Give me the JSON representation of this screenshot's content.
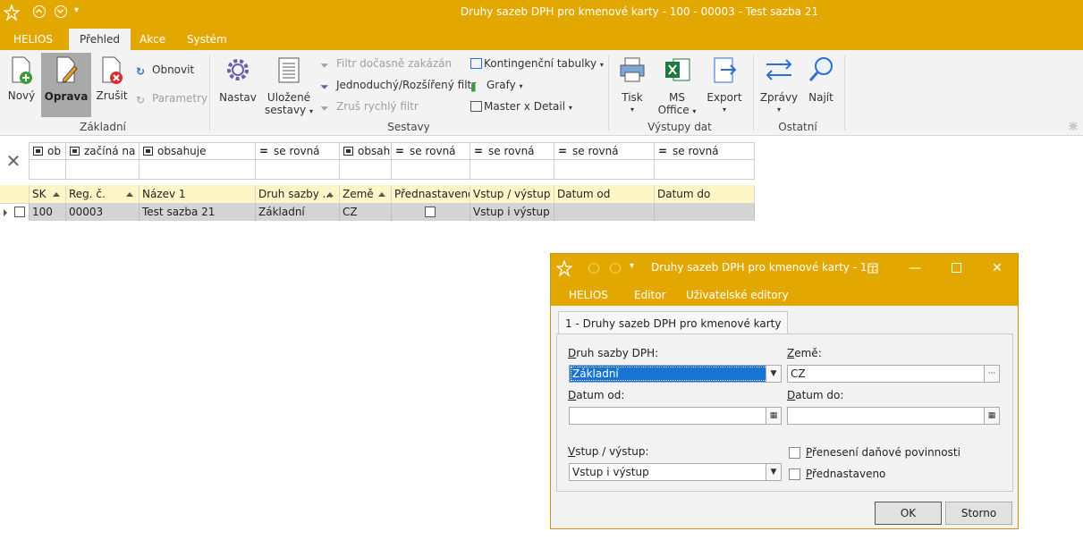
{
  "window": {
    "title": "Druhy sazeb DPH pro kmenové karty - 100 - 00003 - Test sazba 21"
  },
  "ribbon_tabs": [
    "HELIOS",
    "Přehled",
    "Akce",
    "Systém"
  ],
  "ribbon": {
    "zakladni": {
      "new": "Nový",
      "edit": "Oprava",
      "delete": "Zrušit",
      "refresh": "Obnovit",
      "params": "Parametry",
      "group": "Základní"
    },
    "sestavy": {
      "settings": "Nastav",
      "saved": "Uložené",
      "saved2": "sestavy",
      "filter_disabled": "Filtr dočasně zakázán",
      "filter_simple": "Jednoduchý/Rozšířený filtr",
      "filter_quick": "Zruš rychlý filtr",
      "pivot": "Kontingenční tabulky",
      "charts": "Grafy",
      "master": "Master x Detail",
      "group": "Sestavy"
    },
    "vystupy": {
      "print": "Tisk",
      "office1": "MS",
      "office2": "Office",
      "export": "Export",
      "group": "Výstupy dat"
    },
    "ostatni": {
      "reports": "Zprávy",
      "find": "Najít",
      "group": "Ostatní"
    }
  },
  "filter_row": [
    "ob",
    "začíná na",
    "obsahuje",
    "se rovná",
    "obsah",
    "se rovná",
    "se rovná",
    "se rovná",
    "se rovná"
  ],
  "grid": {
    "columns": [
      "SK",
      "Reg. č.",
      "Název 1",
      "Druh sazby ...",
      "Země",
      "Přednastaveno",
      "Vstup / výstup",
      "Datum od",
      "Datum do"
    ],
    "rows": [
      {
        "sk": "100",
        "reg": "00003",
        "nazev": "Test sazba 21",
        "druh": "Základní",
        "zeme": "CZ",
        "prednastaveno": false,
        "vstup": "Vstup i výstup",
        "od": "",
        "do": ""
      }
    ]
  },
  "dialog": {
    "title": "Druhy sazeb DPH pro kmenové karty - 1...",
    "menu": [
      "HELIOS",
      "Editor",
      "Uživatelské editory"
    ],
    "tab": "1 - Druhy sazeb DPH pro kmenové karty",
    "labels": {
      "druh_a": "D",
      "druh_b": "ruh sazby DPH:",
      "zeme_a": "Z",
      "zeme_b": "emě:",
      "od_a": "D",
      "od_b": "atum od:",
      "do_a": "D",
      "do_b": "atum do:",
      "vstup_a": "V",
      "vstup_b": "stup / výstup:",
      "prenes_a": "P",
      "prenes_b": "řenesení daňové povinnosti",
      "pred_a": "P",
      "pred_b": "řednastaveno"
    },
    "values": {
      "druh": "Základní",
      "zeme": "CZ",
      "od": "",
      "do": "",
      "vstup": "Vstup i výstup",
      "prenes": false,
      "pred": false
    },
    "ok": "OK",
    "cancel": "Storno"
  },
  "colors": {
    "accent": "#E3A800",
    "header_bg": "#FFF6C7",
    "selection": "#1874D2"
  }
}
